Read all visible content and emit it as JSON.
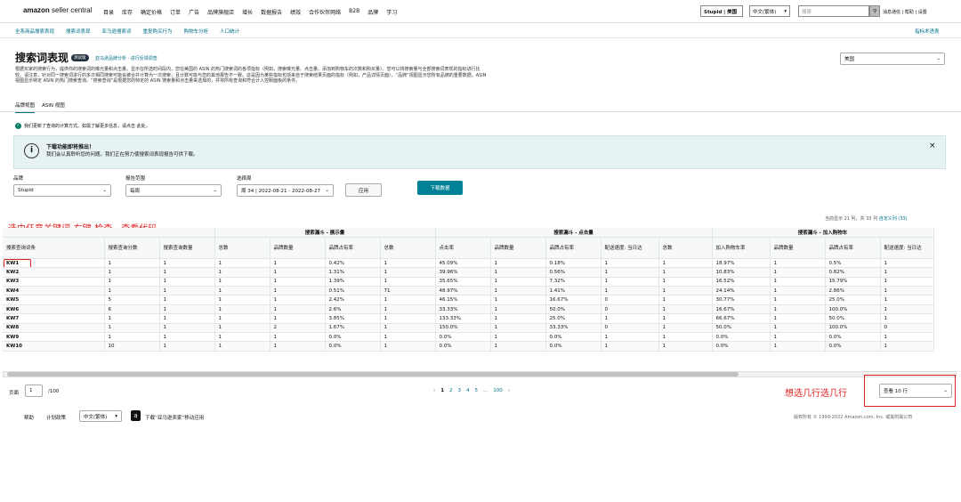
{
  "topnav": {
    "logo_main": "amazon",
    "logo_sub": "seller central",
    "menu": [
      "目录",
      "库存",
      "确定价格",
      "订单",
      "广告",
      "品牌旗舰店",
      "增长",
      "数据报告",
      "绩效",
      "合作伙伴网络",
      "B2B",
      "品牌",
      "学习"
    ],
    "account": "Stupid | 美国",
    "language": "中文(繁体)",
    "search_placeholder": "搜索",
    "links": "消息通信 | 帮助 | 设置"
  },
  "subnav": {
    "items": [
      "全系商品搜索表现",
      "搜索词表现",
      "亚马逊搜索词",
      "重复购买行为",
      "购物车分析",
      "人口统计"
    ],
    "right_link": "指标术语表"
  },
  "page": {
    "title": "搜索词表现",
    "badge": "测试版",
    "links": "亚马逊品牌分析 · 进行反馈调查",
    "desc": "根据买家的搜索行为，提供你的搜索词的曝光量和点击量。显示在所选时间段内，您在美国的 ASIN 的热门搜索词的各项指标（例如，搜索曝光量、点击量、添加到购物车的次数和购买量）。您可以将搜索量与全部搜索词表现的指标进行比较。请注意，针对同一搜索词进行的多次相同搜索可能会被合并计算为一次搜索，且计数可能与您的其他报告不一致。这是因为某些指标包括来自于搜索结果页面的指标（例如，产品详情页面），“品牌”视图显示您所有品牌的重要数据。ASIN 视图显示特定 ASIN 的热门搜索查询。“搜索查询”是根据您的特定的 ASIN 搜索量和点击量来选择的，并将所有查询和符合计入控制面板的条件。",
    "view_select": "美国"
  },
  "tabs": [
    "品牌视图",
    "ASIN 视图"
  ],
  "notice": "我们更新了查询的计算方式。如需了解更多信息，请点击 此处。",
  "banner": {
    "title": "下载功能即将推出！",
    "body": "我们会认真聆听您的问题。我们正在努力使搜索词表现报告可供下载。"
  },
  "filters": {
    "brand_label": "品牌",
    "brand_value": "Stupid",
    "range_label": "报告范围",
    "range_value": "每周",
    "period_label": "选择周",
    "period_value": "周 34 | 2022-08-21 - 2022-08-27",
    "apply": "应用",
    "download": "下载数据"
  },
  "annotations": {
    "left": "选中任意关键词-右键-检查，查看代码",
    "right": "想选几行选几行"
  },
  "table": {
    "summary": "当前显示 21 列，共 33 列",
    "summary_link": "自定义列 (33)",
    "groups": [
      "搜索漏斗 - 展示量",
      "搜索漏斗 - 点击量",
      "搜索漏斗 - 加入购物车"
    ],
    "headers": [
      "搜索查询词条",
      "搜索查询分数",
      "搜索查询数量",
      "总数",
      "品牌数量",
      "品牌占有率",
      "总数",
      "点击率",
      "品牌数量",
      "品牌占有率",
      "配送速度: 当日达",
      "总数",
      "加入购物车率",
      "品牌数量",
      "品牌占有率",
      "配送速度: 当日达"
    ],
    "rows": [
      [
        "KW1",
        "1",
        "1",
        "1",
        "1",
        "0.42%",
        "1",
        "45.09%",
        "1",
        "0.18%",
        "1",
        "1",
        "18.97%",
        "1",
        "0.5%",
        "1"
      ],
      [
        "KW2",
        "1",
        "1",
        "1",
        "1",
        "1.31%",
        "1",
        "39.96%",
        "1",
        "0.56%",
        "1",
        "1",
        "10.83%",
        "1",
        "0.82%",
        "1"
      ],
      [
        "KW3",
        "1",
        "1",
        "1",
        "1",
        "1.39%",
        "1",
        "35.65%",
        "1",
        "7.32%",
        "1",
        "1",
        "16.52%",
        "1",
        "15.79%",
        "1"
      ],
      [
        "KW4",
        "1",
        "1",
        "1",
        "1",
        "0.51%",
        "71",
        "48.97%",
        "1",
        "1.41%",
        "1",
        "1",
        "24.14%",
        "1",
        "2.86%",
        "1"
      ],
      [
        "KW5",
        "5",
        "1",
        "1",
        "1",
        "2.42%",
        "1",
        "46.15%",
        "1",
        "16.67%",
        "0",
        "1",
        "30.77%",
        "1",
        "25.0%",
        "1"
      ],
      [
        "KW6",
        "6",
        "1",
        "1",
        "1",
        "2.6%",
        "1",
        "33.33%",
        "1",
        "50.0%",
        "0",
        "1",
        "16.67%",
        "1",
        "100.0%",
        "1"
      ],
      [
        "KW7",
        "1",
        "1",
        "1",
        "1",
        "3.85%",
        "1",
        "133.33%",
        "1",
        "25.0%",
        "1",
        "1",
        "66.67%",
        "1",
        "50.0%",
        "1"
      ],
      [
        "KW8",
        "1",
        "1",
        "1",
        "2",
        "1.67%",
        "1",
        "150.0%",
        "1",
        "33.33%",
        "0",
        "1",
        "50.0%",
        "1",
        "100.0%",
        "0"
      ],
      [
        "KW9",
        "1",
        "1",
        "1",
        "1",
        "0.0%",
        "1",
        "0.0%",
        "1",
        "0.0%",
        "1",
        "1",
        "0.0%",
        "1",
        "0.0%",
        "1"
      ],
      [
        "KW10",
        "10",
        "1",
        "1",
        "1",
        "0.0%",
        "1",
        "0.0%",
        "1",
        "0.0%",
        "1",
        "1",
        "0.0%",
        "1",
        "0.0%",
        "1"
      ]
    ]
  },
  "pagination": {
    "page_label": "页面",
    "page_value": "1",
    "total": "/100",
    "pages": [
      "‹",
      "1",
      "2",
      "3",
      "4",
      "5",
      "...",
      "100",
      "›"
    ],
    "rows_select": "查看 10 行"
  },
  "footer": {
    "help": "帮助",
    "policy": "计划政策",
    "lang": "中文(繁体)",
    "app": "下载“亚马逊卖家”移动应用",
    "copyright": "版权所有 © 1999-2022 Amazon.com, Inc. 或其附属公司"
  }
}
